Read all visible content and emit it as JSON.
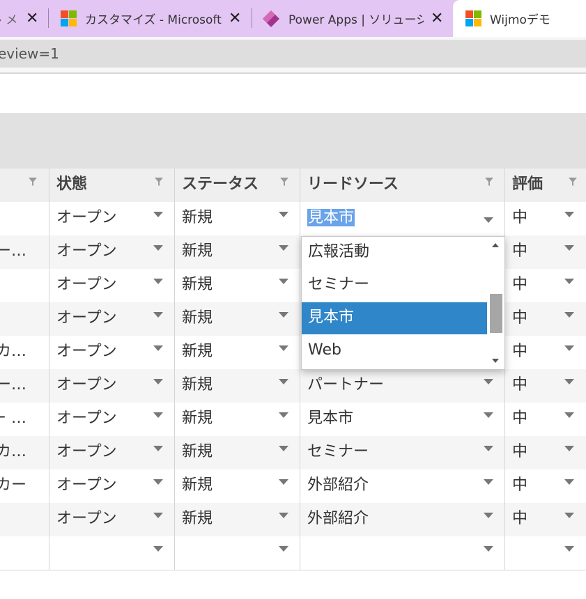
{
  "browser": {
    "tabs": [
      {
        "title": "› メ",
        "close": "✕",
        "icon": "page-icon"
      },
      {
        "title": "カスタマイズ - Microsoft Dy",
        "close": "✕",
        "icon": "microsoft-logo-icon"
      },
      {
        "title": "Power Apps | ソリューション",
        "close": "✕",
        "icon": "power-apps-icon"
      },
      {
        "title": "Wijmoデモ",
        "icon": "microsoft-logo-icon"
      }
    ],
    "address": "eview=1"
  },
  "grid": {
    "columns": [
      {
        "label": "",
        "filter_icon": "filter-icon"
      },
      {
        "label": "状態",
        "filter_icon": "filter-icon"
      },
      {
        "label": "ステータス",
        "filter_icon": "filter-icon"
      },
      {
        "label": "リードソース",
        "filter_icon": "filter-icon"
      },
      {
        "label": "評価",
        "filter_icon": "filter-icon"
      }
    ],
    "rows": [
      {
        "c0": "",
        "state": "オープン",
        "status": "新規",
        "source": "見本市",
        "rating": "中",
        "editing": true
      },
      {
        "c0": "ー…",
        "state": "オープン",
        "status": "新規",
        "source": "",
        "rating": "中"
      },
      {
        "c0": "",
        "state": "オープン",
        "status": "新規",
        "source": "",
        "rating": "中"
      },
      {
        "c0": "",
        "state": "オープン",
        "status": "新規",
        "source": "",
        "rating": "中"
      },
      {
        "c0": "ーカ…",
        "state": "オープン",
        "status": "新規",
        "source": "",
        "rating": "中"
      },
      {
        "c0": "メー…",
        "state": "オープン",
        "status": "新規",
        "source": "パートナー",
        "rating": "中"
      },
      {
        "c0": "ー …",
        "state": "オープン",
        "status": "新規",
        "source": "見本市",
        "rating": "中"
      },
      {
        "c0": "ーカ…",
        "state": "オープン",
        "status": "新規",
        "source": "セミナー",
        "rating": "中"
      },
      {
        "c0": "カー",
        "state": "オープン",
        "status": "新規",
        "source": "外部紹介",
        "rating": "中"
      },
      {
        "c0": "",
        "state": "オープン",
        "status": "新規",
        "source": "外部紹介",
        "rating": "中"
      },
      {
        "c0": "",
        "state": "",
        "status": "",
        "source": "",
        "rating": ""
      }
    ]
  },
  "dropdown": {
    "options": [
      "広報活動",
      "セミナー",
      "見本市",
      "Web"
    ],
    "selected_index": 2,
    "scroll_up_icon": "scroll-up-arrow-icon",
    "scroll_down_icon": "scroll-down-arrow-icon"
  },
  "colors": {
    "tabbar": "#e3c6f4",
    "header_bg": "#efefef",
    "alt_row": "#f5f5f5",
    "selection_bg": "#2f86c9",
    "text_highlight": "#6aa3e9",
    "ms_red": "#f25022",
    "ms_green": "#7fba00",
    "ms_blue": "#00a4ef",
    "ms_yellow": "#ffb900",
    "power_apps": "#a4338b"
  }
}
